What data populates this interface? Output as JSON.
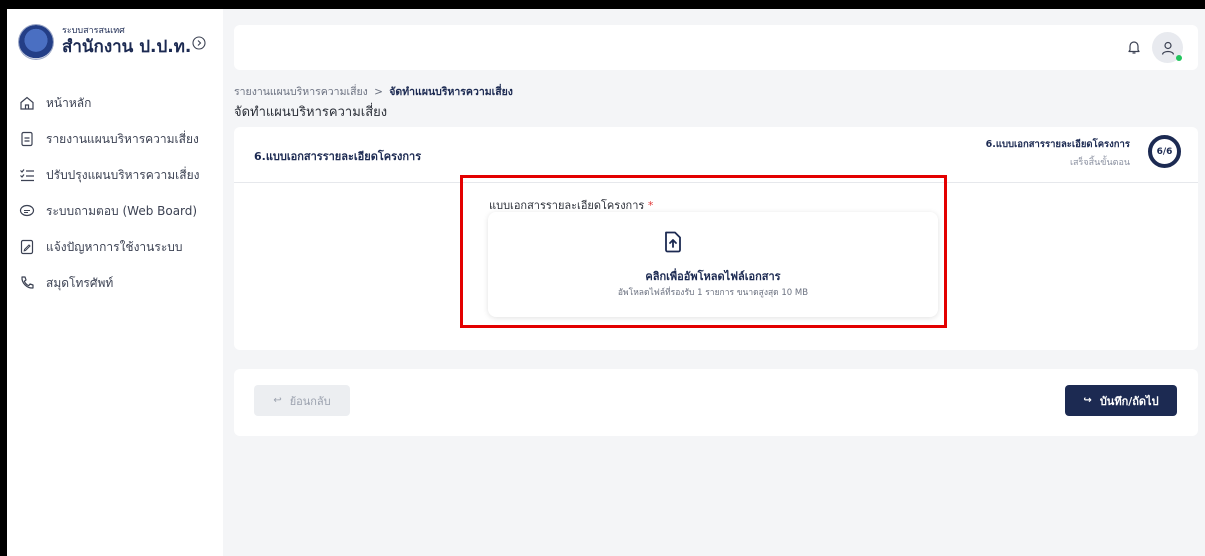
{
  "brand": {
    "subtitle": "ระบบสารสนเทศ",
    "title": "สำนักงาน ป.ป.ท."
  },
  "sidebar": {
    "items": [
      {
        "label": "หน้าหลัก",
        "icon": "home-icon"
      },
      {
        "label": "รายงานแผนบริหารความเสี่ยง",
        "icon": "document-icon"
      },
      {
        "label": "ปรับปรุงแผนบริหารความเสี่ยง",
        "icon": "list-icon"
      },
      {
        "label": "ระบบถามตอบ (Web Board)",
        "icon": "chat-icon"
      },
      {
        "label": "แจ้งปัญหาการใช้งานระบบ",
        "icon": "report-icon"
      },
      {
        "label": "สมุดโทรศัพท์",
        "icon": "phone-icon"
      }
    ]
  },
  "breadcrumb": {
    "parent": "รายงานแผนบริหารความเสี่ยง",
    "separator": ">",
    "current": "จัดทำแผนบริหารความเสี่ยง"
  },
  "page": {
    "title": "จัดทำแผนบริหารความเสี่ยง"
  },
  "step": {
    "title": "6.แบบเอกสารรายละเอียดโครงการ",
    "right_title": "6.แบบเอกสารรายละเอียดโครงการ",
    "right_sub": "เสร็จสิ้นขั้นตอน",
    "progress": "6/6"
  },
  "upload": {
    "label": "แบบเอกสารรายละเอียดโครงการ",
    "required_mark": "*",
    "title": "คลิกเพื่ออัพโหลดไฟล์เอกสาร",
    "subtitle": "อัพโหลดไฟล์ที่รองรับ 1 รายการ ขนาดสูงสุด 10 MB"
  },
  "actions": {
    "back_label": "ย้อนกลับ",
    "next_label": "บันทึก/ถัดไป"
  },
  "colors": {
    "primary": "#1c2a52",
    "highlight": "#e30000",
    "online": "#21c55d"
  }
}
